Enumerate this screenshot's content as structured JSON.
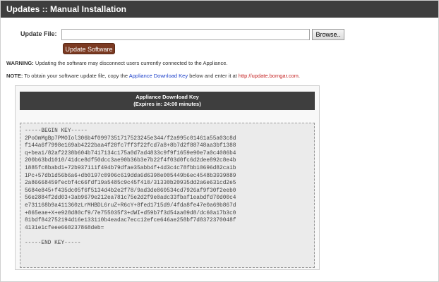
{
  "header": {
    "title": "Updates :: Manual Installation"
  },
  "upload": {
    "label": "Update File:",
    "file_value": "",
    "browse_label": "Browse..",
    "update_label": "Update Software"
  },
  "warning": {
    "label": "WARNING:",
    "text": " Updating the software may disconnect users currently connected to the Appliance."
  },
  "note": {
    "label": "NOTE:",
    "text_before": " To obtain your software update file, copy the ",
    "link_key": "Appliance Download Key",
    "text_middle": " below and enter it at ",
    "link_url": "http://update.bomgar.com",
    "text_after": "."
  },
  "key_panel": {
    "title": "Appliance Download Key",
    "subtitle": "(Expires in: 24:00 minutes)",
    "key": "-----BEGIN KEY-----\n2PoOmMgBp7PMOIol306b4f0997351717523245e344/f2a995c01461a55a03c8d\nf144a6f7998e169ab4222baa4f28fc7ff3f22fcd7a8+8b7d2f88748aa3bf1388\nq+bea1/82af2238b604b7417134c175a0d7ad4833c9f9f1659e90e7a0c4086b4\n200b63bd1010/41dce8df50dcc3ae90b36b3e7b22f4f03d0fc6d2dee892c8e4b\n1885fc8babd1+72b937111f494b79dfae35abb4f+4d3c4c78fbb10696d82ca1b\n1Pc+57db1d56b6a6+db0197c0906c619dda6d6398e005449b6ec4548b3939889\n2a86668459fecbf4c66fdf19a5485c9c45f410/31330b20935dd2a6e631cd2e5\n5684e845+f435dc05f6f5134d4b2e2f78/9ad3de860534cd7926af9f30f2eeb0\n56e2884f2dd03+3ab9679e212ea781c75e2d2f9e0adc33fbaf1eabdfd70d00c4\ne731168b9a411360zLrMHBDL6ruZ+R6cY+8fed1715d9/4fda8fe47e0a69b867d\n+865eae+X+e928d80cf9/7e755035f3+dWI+d59b7f3d54aa09d8/dc60a17b3c0\n81bdf842752194d16e133110b4eadac7ecc12efce646ae258bf7d8372370048f\n4131e1cfeee660237868deb=\n\n-----END KEY-----"
  }
}
